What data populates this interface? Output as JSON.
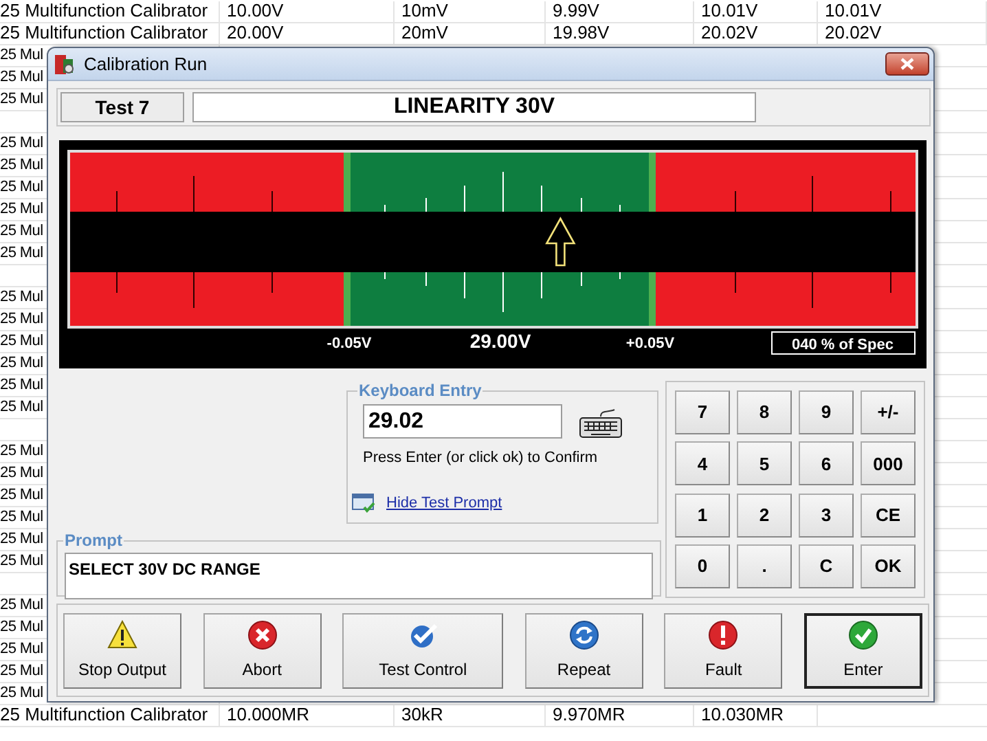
{
  "sheet": {
    "rows": [
      {
        "kind": "row",
        "cells": [
          "25 Multifunction Calibrator",
          "10.00V",
          "10mV",
          "9.99V",
          "10.01V",
          "10.01V"
        ]
      },
      {
        "kind": "row",
        "cells": [
          "25 Multifunction Calibrator",
          "20.00V",
          "20mV",
          "19.98V",
          "20.02V",
          "20.02V"
        ]
      },
      {
        "kind": "row",
        "cells": [
          "25 Mul"
        ]
      },
      {
        "kind": "row",
        "cells": [
          "25 Mul"
        ]
      },
      {
        "kind": "row",
        "cells": [
          "25 Mul"
        ]
      },
      {
        "kind": "gap"
      },
      {
        "kind": "row",
        "cells": [
          "25 Mul"
        ]
      },
      {
        "kind": "row",
        "cells": [
          "25 Mul"
        ]
      },
      {
        "kind": "row",
        "cells": [
          "25 Mul"
        ]
      },
      {
        "kind": "row",
        "cells": [
          "25 Mul"
        ]
      },
      {
        "kind": "row",
        "cells": [
          "25 Mul"
        ]
      },
      {
        "kind": "row",
        "cells": [
          "25 Mul"
        ]
      },
      {
        "kind": "gap"
      },
      {
        "kind": "row",
        "cells": [
          "25 Mul"
        ]
      },
      {
        "kind": "row",
        "cells": [
          "25 Mul"
        ]
      },
      {
        "kind": "row",
        "cells": [
          "25 Mul"
        ]
      },
      {
        "kind": "row",
        "cells": [
          "25 Mul"
        ]
      },
      {
        "kind": "row",
        "cells": [
          "25 Mul"
        ]
      },
      {
        "kind": "row",
        "cells": [
          "25 Mul"
        ]
      },
      {
        "kind": "gap"
      },
      {
        "kind": "row",
        "cells": [
          "25 Mul"
        ]
      },
      {
        "kind": "row",
        "cells": [
          "25 Mul"
        ]
      },
      {
        "kind": "row",
        "cells": [
          "25 Mul"
        ]
      },
      {
        "kind": "row",
        "cells": [
          "25 Mul"
        ]
      },
      {
        "kind": "row",
        "cells": [
          "25 Mul"
        ]
      },
      {
        "kind": "row",
        "cells": [
          "25 Mul"
        ]
      },
      {
        "kind": "gap"
      },
      {
        "kind": "row",
        "cells": [
          "25 Mul"
        ]
      },
      {
        "kind": "row",
        "cells": [
          "25 Mul"
        ]
      },
      {
        "kind": "row",
        "cells": [
          "25 Mul"
        ]
      },
      {
        "kind": "row",
        "cells": [
          "25 Mul"
        ]
      },
      {
        "kind": "row",
        "cells": [
          "25 Mul"
        ]
      },
      {
        "kind": "row",
        "cells": [
          "25 Multifunction Calibrator",
          "10.000MR",
          "30kR",
          "9.970MR",
          "10.030MR"
        ]
      }
    ]
  },
  "dialog": {
    "title": "Calibration Run",
    "test_label": "Test 7",
    "test_name": "LINEARITY 30V",
    "meter": {
      "level": 0.58,
      "lower_limit": "-0.05V",
      "nominal": "29.00V",
      "upper_limit": "+0.05V",
      "spec": "040 % of Spec"
    },
    "keyboard_entry": {
      "label": "Keyboard Entry",
      "value": "29.02",
      "hint": "Press Enter (or click ok) to Confirm",
      "link": "Hide Test Prompt"
    },
    "prompt": {
      "label": "Prompt",
      "text": "SELECT 30V DC RANGE"
    },
    "keypad": [
      "7",
      "8",
      "9",
      "+/-",
      "4",
      "5",
      "6",
      "000",
      "1",
      "2",
      "3",
      "CE",
      "0",
      ".",
      "C",
      "OK"
    ],
    "actions": [
      {
        "label": "Stop Output",
        "kind": "warning",
        "default": false
      },
      {
        "label": "Abort",
        "kind": "abort",
        "default": false
      },
      {
        "label": "Test Control",
        "kind": "control",
        "default": false
      },
      {
        "label": "Repeat",
        "kind": "repeat",
        "default": false
      },
      {
        "label": "Fault",
        "kind": "fault",
        "default": false
      },
      {
        "label": "Enter",
        "kind": "enter",
        "default": true
      }
    ]
  }
}
